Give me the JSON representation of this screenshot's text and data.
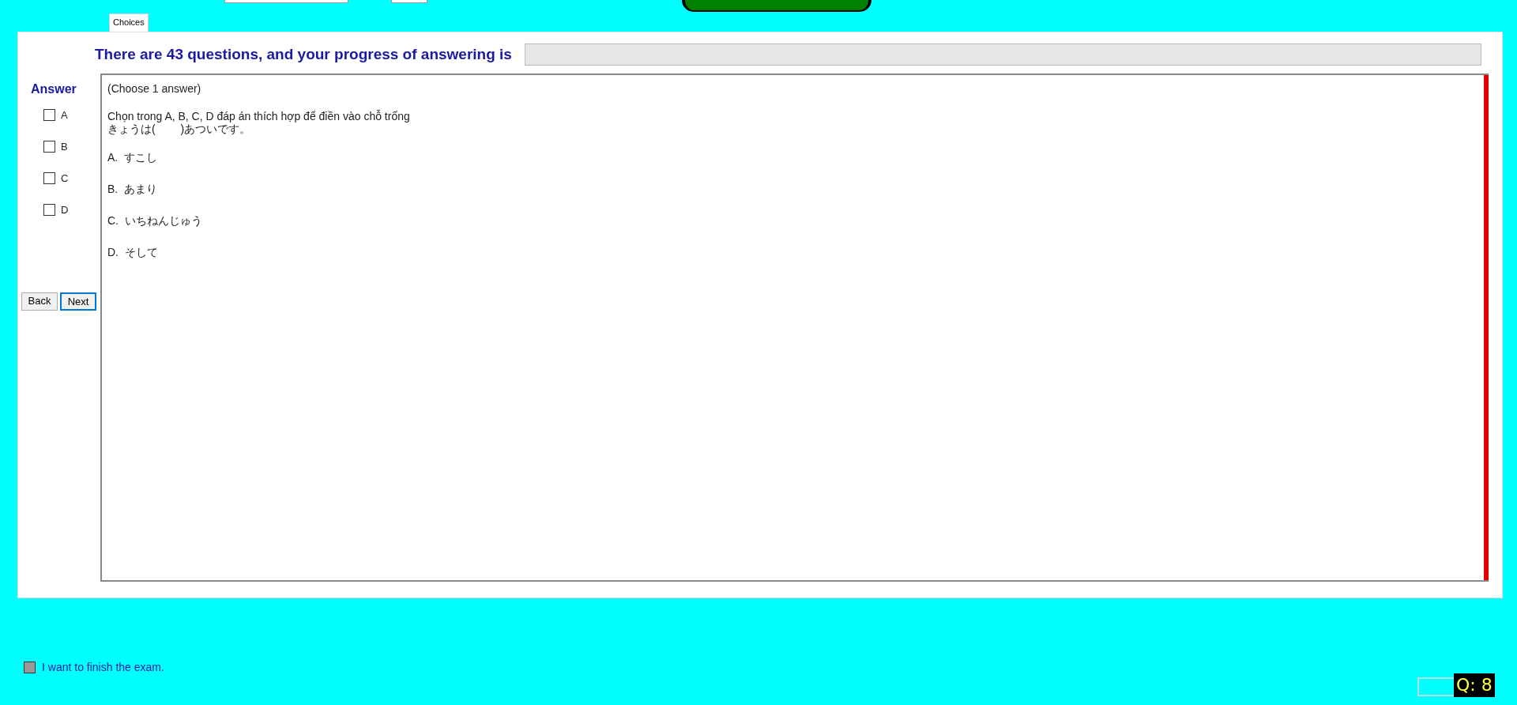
{
  "tabs": [
    {
      "label": "Choices",
      "selected": true
    }
  ],
  "progress": {
    "label": "There are 43 questions, and your progress of answering is",
    "level": 0
  },
  "answer": {
    "title": "Answer",
    "options": [
      {
        "label": "A",
        "checked": false
      },
      {
        "label": "B",
        "checked": false
      },
      {
        "label": "C",
        "checked": false
      },
      {
        "label": "D",
        "checked": false
      }
    ]
  },
  "nav_buttons": [
    {
      "label": "Back",
      "selected": false
    },
    {
      "label": "Next",
      "selected": true
    }
  ],
  "question": {
    "instruction": "(Choose 1 answer)",
    "lines": [
      "Chọn trong A, B, C, D đáp án thích hợp để điền vào chỗ trống",
      "きょうは(　　 )あついです。"
    ],
    "choices": [
      "A.  すこし",
      "B.  あまり",
      "C.  いちねんじゅう",
      "D.  そして"
    ]
  },
  "finish": {
    "label": "I want to finish the exam.",
    "checked": false
  },
  "question_number": "Q: 8"
}
